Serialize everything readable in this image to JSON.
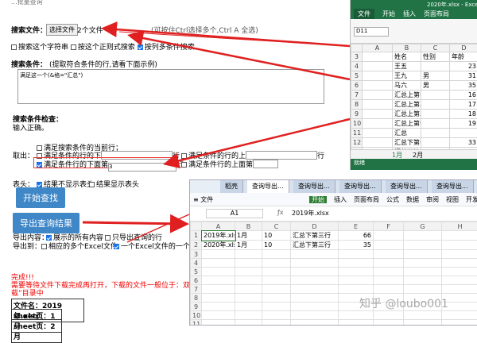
{
  "form": {
    "top_cut": "...批量查询",
    "search_file_label": "搜索文件：",
    "choose_file_button": "选择文件",
    "file_count": "2个文件",
    "ctrl_hint": "(可按住Ctrl选择多个,Ctrl A 全选)",
    "options": [
      {
        "label": "搜索这个字符串",
        "checked": false
      },
      {
        "label": "按这个正则式搜索",
        "checked": false
      },
      {
        "label": "按列多条件搜索",
        "checked": true
      }
    ],
    "condition_label": "搜索条件：",
    "condition_hint": "(提取符合条件的行,请看下面示例)",
    "condition_value": "满足这一个(&格=\"汇总\")",
    "check_label": "搜索条件检查：",
    "check_result": "输入正确。",
    "take_label": "取出：",
    "take_row_current": "满足搜索条件的当前行；",
    "take_row_below_n": "满足条件的行的下",
    "take_row_above_n": "满足条件的行的上",
    "take_row_below_n_sec": "满足条件行的下面第",
    "take_row_above_sec": "满足条件行的上面第",
    "row_suffix": "行",
    "below_value": "3",
    "header_label": "表头：",
    "header_options": [
      {
        "label": "结果不显示表头",
        "checked": true
      },
      {
        "label": "结果显示表头",
        "checked": false
      }
    ],
    "start_button": "开始查找",
    "export_button": "导出查询结果",
    "export_content_label": "导出内容：",
    "export_all": "展示的所有内容",
    "export_only": "只导出查询的行",
    "export_to_label": "导出到：",
    "export_to_1": "相应的多个Excel文件",
    "export_to_2": "一个Excel文件的一个表",
    "done": "完成!!!",
    "notice": "需要等待文件下载完成再打开，下载的文件一般位于：双击此",
    "notice2": "载”目录中",
    "result_file": "文件名：2019年.xlsx",
    "result_sheet": "sheet页：1月",
    "result_sheet2": "sheet页：2月"
  },
  "excel": {
    "title": "2020年.xlsx - Excel...",
    "menu": [
      "文件",
      "开始",
      "插入",
      "页面布局"
    ],
    "namebox": "D11",
    "col_headers": [
      "A",
      "B",
      "C",
      "D",
      "E"
    ],
    "headers": [
      "姓名",
      "性别",
      "年龄",
      "工作单位"
    ],
    "rows": [
      [
        "王五",
        "",
        "23",
        "1公司"
      ],
      [
        "王九",
        "男",
        "31",
        "2公司"
      ],
      [
        "马六",
        "男",
        "35",
        "1公司"
      ],
      [
        "汇总上第一行",
        "",
        "16",
        ""
      ],
      [
        "汇总上第二行",
        "",
        "17",
        ""
      ],
      [
        "汇总上第三行",
        "",
        "18",
        ""
      ],
      [
        "汇总上第一行",
        "",
        "19",
        ""
      ],
      [
        "汇总",
        "",
        "",
        ""
      ],
      [
        "汇总下第一行",
        "",
        "33",
        ""
      ],
      [
        "汇总下第二行",
        "",
        "34",
        ""
      ],
      [
        "汇总下第三行",
        "",
        "35",
        ""
      ]
    ],
    "row_numbers": [
      "3",
      "4",
      "5",
      "6",
      "7",
      "8",
      "9",
      "10",
      "11",
      "12",
      "13",
      "14",
      "15",
      "16"
    ],
    "sheet_tabs": [
      "1月",
      "2月"
    ],
    "status": "就绪"
  },
  "wps": {
    "tabs": [
      "稻壳",
      "查询导出...",
      "查询导出...",
      "查询导出...",
      "查询导出...",
      "查询导出..."
    ],
    "menu_file": "文件",
    "menu": [
      "开始",
      "插入",
      "页面布局",
      "公式",
      "数据",
      "审阅",
      "视图",
      "开发工具",
      "会员专享"
    ],
    "namebox": "A1",
    "formula": "2019年.xlsx",
    "col_headers": [
      "A",
      "B",
      "C",
      "D",
      "E",
      "F",
      "G",
      "H"
    ],
    "row_numbers": [
      "1",
      "2",
      "3",
      "4",
      "5",
      "6",
      "7",
      "8",
      "9",
      "10",
      "11"
    ],
    "rows": [
      [
        "2019年.xlsx",
        "1月",
        "10",
        "汇总下第三行",
        "66"
      ],
      [
        "2020年.xlsx",
        "1月",
        "10",
        "汇总下第三行",
        "35"
      ]
    ]
  },
  "watermark": "知乎 @loubo001",
  "colors": {
    "excel_green": "#217346",
    "button_blue": "#3f87c7",
    "arrow_red": "#e02020",
    "wps_tabbar": "#d8e3f0"
  }
}
